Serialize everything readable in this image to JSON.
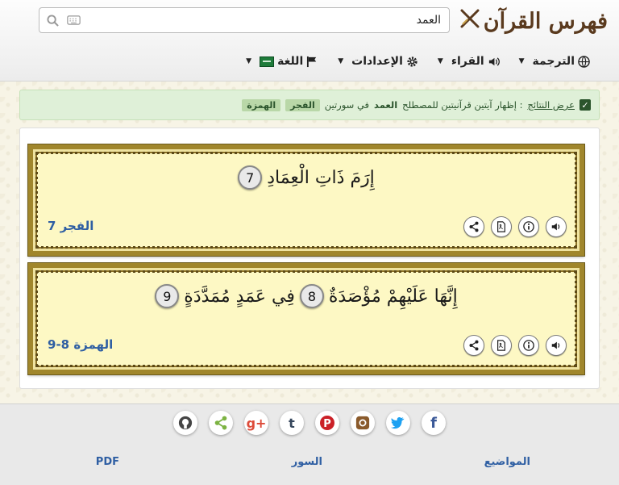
{
  "header": {
    "logo_text": "فهرس القرآن",
    "search": {
      "value": "العمد",
      "placeholder": ""
    },
    "nav": [
      {
        "label": "الترجمة",
        "icon": "globe-icon"
      },
      {
        "label": "القراء",
        "icon": "volume-icon"
      },
      {
        "label": "الإعدادات",
        "icon": "gear-icon"
      },
      {
        "label": "اللغة",
        "icon": "flag-icon"
      }
    ]
  },
  "alert": {
    "prefix": "عرض النتائج",
    "text_before": ": إظهار آيتين قرآنيتين للمصطلح",
    "term": "العمد",
    "text_after": "في سورتين",
    "tags": [
      "الفجر",
      "الهمزة"
    ]
  },
  "results": [
    {
      "verse_parts": [
        "إِرَمَ ذَاتِ الْعِمَادِ"
      ],
      "numbers": [
        "7"
      ],
      "reference": "الفجر 7"
    },
    {
      "verse_parts": [
        "إِنَّهَا عَلَيْهِمْ مُؤْصَدَةٌ",
        "فِي عَمَدٍ مُمَدَّدَةٍ"
      ],
      "numbers": [
        "8",
        "9"
      ],
      "reference": "الهمزة 8-9"
    }
  ],
  "footer": {
    "social": [
      "github-icon",
      "share-icon",
      "google-plus-icon",
      "tumblr-icon",
      "pinterest-icon",
      "instagram-icon",
      "twitter-icon",
      "facebook-icon"
    ],
    "links": [
      "المواضيع",
      "السور",
      "PDF"
    ]
  },
  "colors": {
    "accent": "#2f5fa3",
    "logo": "#5a3a1e",
    "card_bg": "#fdf8c4",
    "alert_bg": "#dff0d8"
  }
}
